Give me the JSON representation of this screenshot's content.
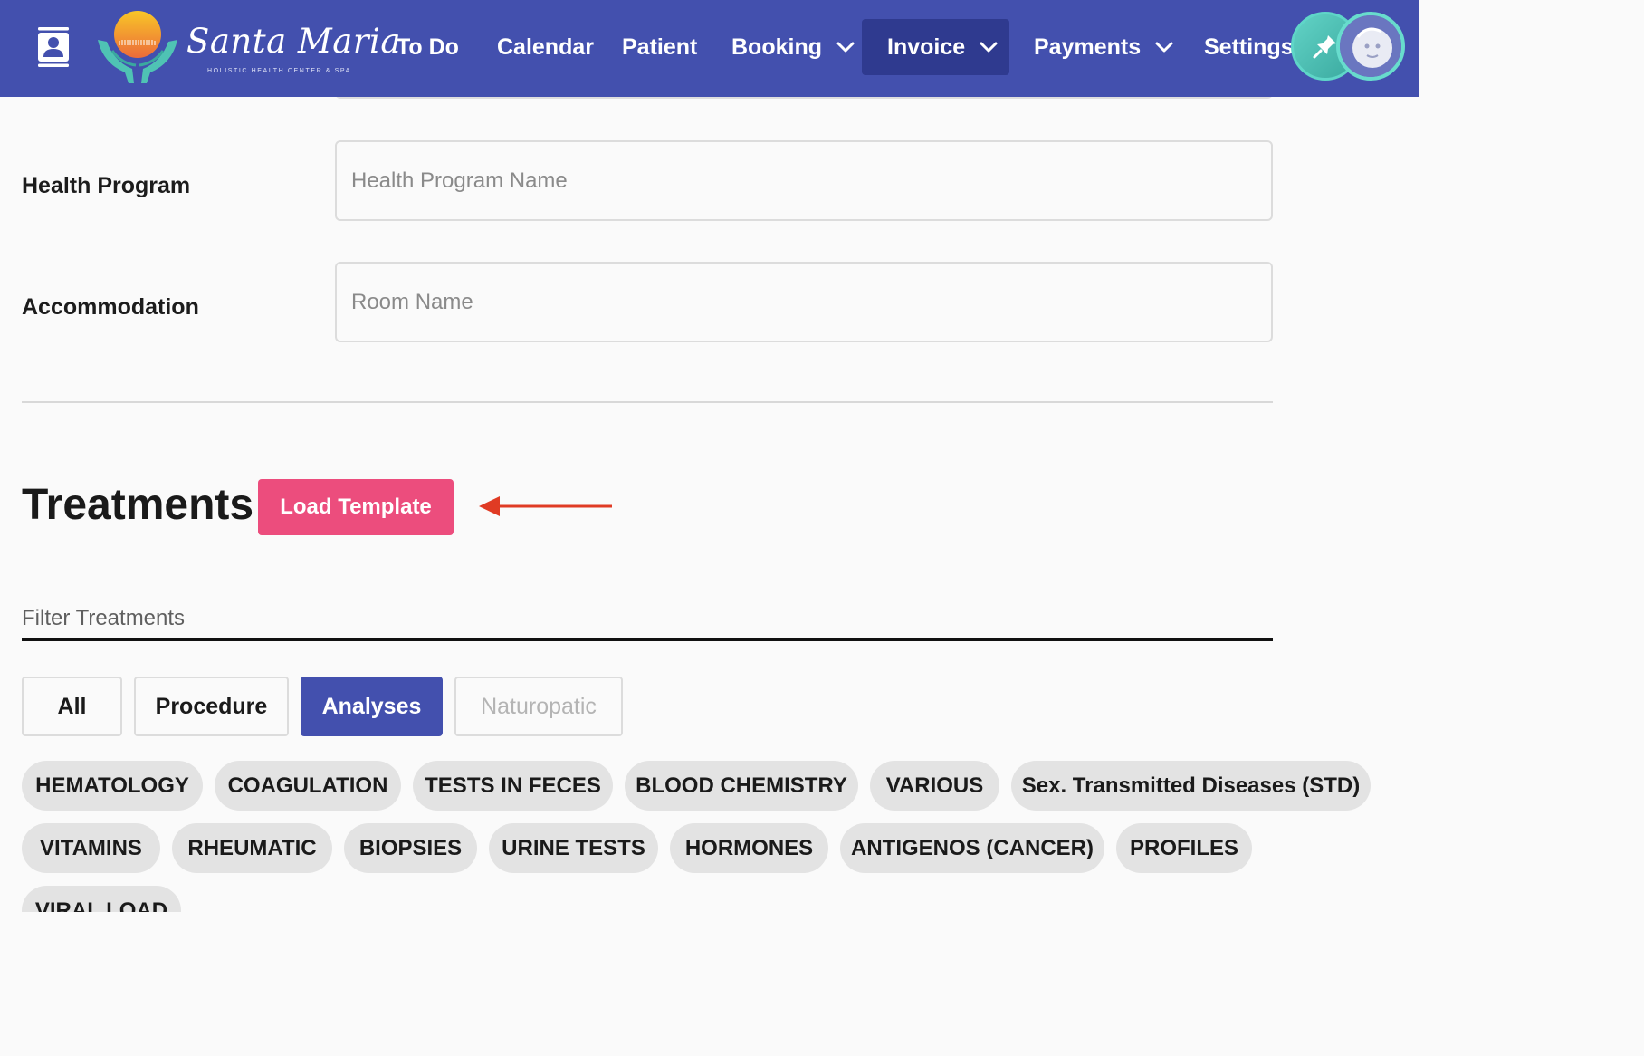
{
  "nav": {
    "logo": {
      "name": "Santa Maria",
      "tagline": "HOLISTIC HEALTH CENTER & SPA"
    },
    "items": [
      {
        "label": "To Do"
      },
      {
        "label": "Calendar"
      },
      {
        "label": "Patient"
      },
      {
        "label": "Booking",
        "has_dropdown": true
      },
      {
        "label": "Invoice",
        "has_dropdown": true,
        "active": true
      },
      {
        "label": "Payments",
        "has_dropdown": true
      },
      {
        "label": "Settings"
      }
    ],
    "icons": {
      "menu": "contact-card-icon",
      "pin": "pin-icon",
      "avatar": "user-avatar"
    },
    "colors": {
      "bar": "#4350ae",
      "active": "#2f3a8f",
      "avatar_ring": "#5fd6c8"
    }
  },
  "form": {
    "health_program": {
      "label": "Health Program",
      "placeholder": "Health Program Name"
    },
    "accommodation": {
      "label": "Accommodation",
      "placeholder": "Room Name"
    }
  },
  "treatments": {
    "title": "Treatments",
    "load_template_label": "Load Template",
    "load_template_color": "#ec4d7d",
    "annotation_arrow_color": "#e03b24",
    "filter_placeholder": "Filter Treatments",
    "type_toggles": [
      {
        "label": "All"
      },
      {
        "label": "Procedure"
      },
      {
        "label": "Analyses",
        "selected": true
      },
      {
        "label": "Naturopatic",
        "disabled": true
      }
    ],
    "categories": [
      "HEMATOLOGY",
      "COAGULATION",
      "TESTS IN FECES",
      "BLOOD CHEMISTRY",
      "VARIOUS",
      "Sex. Transmitted Diseases (STD)",
      "VITAMINS",
      "RHEUMATIC",
      "BIOPSIES",
      "URINE TESTS",
      "HORMONES",
      "ANTIGENOS (CANCER)",
      "PROFILES",
      "VIRAL LOAD"
    ]
  }
}
